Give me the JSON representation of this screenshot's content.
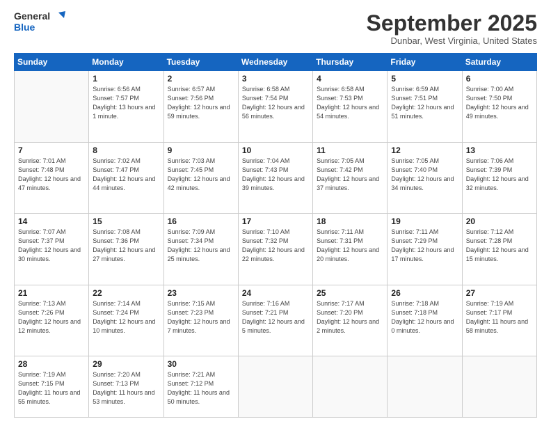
{
  "header": {
    "logo_line1": "General",
    "logo_line2": "Blue",
    "month": "September 2025",
    "location": "Dunbar, West Virginia, United States"
  },
  "weekdays": [
    "Sunday",
    "Monday",
    "Tuesday",
    "Wednesday",
    "Thursday",
    "Friday",
    "Saturday"
  ],
  "weeks": [
    [
      {
        "day": "",
        "sunrise": "",
        "sunset": "",
        "daylight": ""
      },
      {
        "day": "1",
        "sunrise": "Sunrise: 6:56 AM",
        "sunset": "Sunset: 7:57 PM",
        "daylight": "Daylight: 13 hours and 1 minute."
      },
      {
        "day": "2",
        "sunrise": "Sunrise: 6:57 AM",
        "sunset": "Sunset: 7:56 PM",
        "daylight": "Daylight: 12 hours and 59 minutes."
      },
      {
        "day": "3",
        "sunrise": "Sunrise: 6:58 AM",
        "sunset": "Sunset: 7:54 PM",
        "daylight": "Daylight: 12 hours and 56 minutes."
      },
      {
        "day": "4",
        "sunrise": "Sunrise: 6:58 AM",
        "sunset": "Sunset: 7:53 PM",
        "daylight": "Daylight: 12 hours and 54 minutes."
      },
      {
        "day": "5",
        "sunrise": "Sunrise: 6:59 AM",
        "sunset": "Sunset: 7:51 PM",
        "daylight": "Daylight: 12 hours and 51 minutes."
      },
      {
        "day": "6",
        "sunrise": "Sunrise: 7:00 AM",
        "sunset": "Sunset: 7:50 PM",
        "daylight": "Daylight: 12 hours and 49 minutes."
      }
    ],
    [
      {
        "day": "7",
        "sunrise": "Sunrise: 7:01 AM",
        "sunset": "Sunset: 7:48 PM",
        "daylight": "Daylight: 12 hours and 47 minutes."
      },
      {
        "day": "8",
        "sunrise": "Sunrise: 7:02 AM",
        "sunset": "Sunset: 7:47 PM",
        "daylight": "Daylight: 12 hours and 44 minutes."
      },
      {
        "day": "9",
        "sunrise": "Sunrise: 7:03 AM",
        "sunset": "Sunset: 7:45 PM",
        "daylight": "Daylight: 12 hours and 42 minutes."
      },
      {
        "day": "10",
        "sunrise": "Sunrise: 7:04 AM",
        "sunset": "Sunset: 7:43 PM",
        "daylight": "Daylight: 12 hours and 39 minutes."
      },
      {
        "day": "11",
        "sunrise": "Sunrise: 7:05 AM",
        "sunset": "Sunset: 7:42 PM",
        "daylight": "Daylight: 12 hours and 37 minutes."
      },
      {
        "day": "12",
        "sunrise": "Sunrise: 7:05 AM",
        "sunset": "Sunset: 7:40 PM",
        "daylight": "Daylight: 12 hours and 34 minutes."
      },
      {
        "day": "13",
        "sunrise": "Sunrise: 7:06 AM",
        "sunset": "Sunset: 7:39 PM",
        "daylight": "Daylight: 12 hours and 32 minutes."
      }
    ],
    [
      {
        "day": "14",
        "sunrise": "Sunrise: 7:07 AM",
        "sunset": "Sunset: 7:37 PM",
        "daylight": "Daylight: 12 hours and 30 minutes."
      },
      {
        "day": "15",
        "sunrise": "Sunrise: 7:08 AM",
        "sunset": "Sunset: 7:36 PM",
        "daylight": "Daylight: 12 hours and 27 minutes."
      },
      {
        "day": "16",
        "sunrise": "Sunrise: 7:09 AM",
        "sunset": "Sunset: 7:34 PM",
        "daylight": "Daylight: 12 hours and 25 minutes."
      },
      {
        "day": "17",
        "sunrise": "Sunrise: 7:10 AM",
        "sunset": "Sunset: 7:32 PM",
        "daylight": "Daylight: 12 hours and 22 minutes."
      },
      {
        "day": "18",
        "sunrise": "Sunrise: 7:11 AM",
        "sunset": "Sunset: 7:31 PM",
        "daylight": "Daylight: 12 hours and 20 minutes."
      },
      {
        "day": "19",
        "sunrise": "Sunrise: 7:11 AM",
        "sunset": "Sunset: 7:29 PM",
        "daylight": "Daylight: 12 hours and 17 minutes."
      },
      {
        "day": "20",
        "sunrise": "Sunrise: 7:12 AM",
        "sunset": "Sunset: 7:28 PM",
        "daylight": "Daylight: 12 hours and 15 minutes."
      }
    ],
    [
      {
        "day": "21",
        "sunrise": "Sunrise: 7:13 AM",
        "sunset": "Sunset: 7:26 PM",
        "daylight": "Daylight: 12 hours and 12 minutes."
      },
      {
        "day": "22",
        "sunrise": "Sunrise: 7:14 AM",
        "sunset": "Sunset: 7:24 PM",
        "daylight": "Daylight: 12 hours and 10 minutes."
      },
      {
        "day": "23",
        "sunrise": "Sunrise: 7:15 AM",
        "sunset": "Sunset: 7:23 PM",
        "daylight": "Daylight: 12 hours and 7 minutes."
      },
      {
        "day": "24",
        "sunrise": "Sunrise: 7:16 AM",
        "sunset": "Sunset: 7:21 PM",
        "daylight": "Daylight: 12 hours and 5 minutes."
      },
      {
        "day": "25",
        "sunrise": "Sunrise: 7:17 AM",
        "sunset": "Sunset: 7:20 PM",
        "daylight": "Daylight: 12 hours and 2 minutes."
      },
      {
        "day": "26",
        "sunrise": "Sunrise: 7:18 AM",
        "sunset": "Sunset: 7:18 PM",
        "daylight": "Daylight: 12 hours and 0 minutes."
      },
      {
        "day": "27",
        "sunrise": "Sunrise: 7:19 AM",
        "sunset": "Sunset: 7:17 PM",
        "daylight": "Daylight: 11 hours and 58 minutes."
      }
    ],
    [
      {
        "day": "28",
        "sunrise": "Sunrise: 7:19 AM",
        "sunset": "Sunset: 7:15 PM",
        "daylight": "Daylight: 11 hours and 55 minutes."
      },
      {
        "day": "29",
        "sunrise": "Sunrise: 7:20 AM",
        "sunset": "Sunset: 7:13 PM",
        "daylight": "Daylight: 11 hours and 53 minutes."
      },
      {
        "day": "30",
        "sunrise": "Sunrise: 7:21 AM",
        "sunset": "Sunset: 7:12 PM",
        "daylight": "Daylight: 11 hours and 50 minutes."
      },
      {
        "day": "",
        "sunrise": "",
        "sunset": "",
        "daylight": ""
      },
      {
        "day": "",
        "sunrise": "",
        "sunset": "",
        "daylight": ""
      },
      {
        "day": "",
        "sunrise": "",
        "sunset": "",
        "daylight": ""
      },
      {
        "day": "",
        "sunrise": "",
        "sunset": "",
        "daylight": ""
      }
    ]
  ]
}
